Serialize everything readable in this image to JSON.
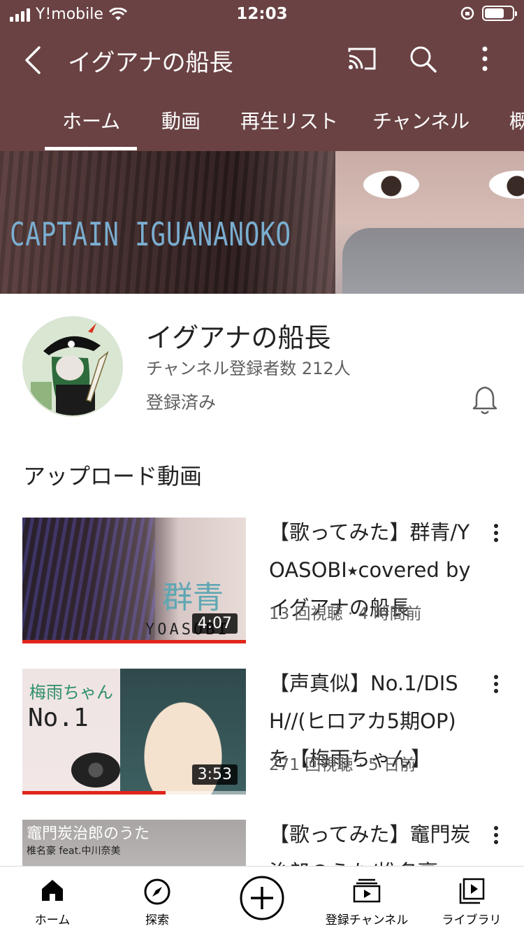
{
  "status_bar": {
    "carrier": "Y!mobile",
    "time": "12:03",
    "battery_level": 0.7
  },
  "app_bar": {
    "title": "イグアナの船長",
    "icons": [
      "back-icon",
      "cast-icon",
      "search-icon",
      "more-vert-icon"
    ]
  },
  "tabs": [
    {
      "label": "ホーム",
      "selected": true
    },
    {
      "label": "動画",
      "selected": false
    },
    {
      "label": "再生リスト",
      "selected": false
    },
    {
      "label": "チャンネル",
      "selected": false
    },
    {
      "label": "概",
      "selected": false
    }
  ],
  "banner": {
    "text": "CAPTAIN IGUANANOKO"
  },
  "channel": {
    "name": "イグアナの船長",
    "subscribers": "チャンネル登録者数 212人",
    "subscription_status": "登録済み"
  },
  "section": {
    "title": "アップロード動画"
  },
  "videos": [
    {
      "title": "【歌ってみた】群青/YOASOBI⭑covered by イグアナの船長",
      "meta": "13 回視聴 · 4 時間前",
      "duration": "4:07",
      "watched_fraction": 1.0,
      "thumb_text": [
        "群青",
        "YOASOBI"
      ]
    },
    {
      "title": "【声真似】No.1/DISH//(ヒロアカ5期OP)を【梅雨ちゃん】",
      "meta": "271 回視聴 · 5 日前",
      "duration": "3:53",
      "watched_fraction": 0.64,
      "thumb_text": [
        "梅雨ちゃん",
        "No.1"
      ]
    },
    {
      "title": "【歌ってみた】竈門炭治郎のうた/椎名豪",
      "meta": "",
      "duration": "",
      "watched_fraction": 0,
      "thumb_text": [
        "竈門炭治郎のうた",
        "椎名豪 feat.中川奈美"
      ]
    }
  ],
  "bottom_nav": [
    {
      "label": "ホーム",
      "icon": "home-icon",
      "selected": true
    },
    {
      "label": "探索",
      "icon": "compass-icon",
      "selected": false
    },
    {
      "label": "",
      "icon": "create-icon",
      "selected": false
    },
    {
      "label": "登録チャンネル",
      "icon": "subscriptions-icon",
      "selected": false
    },
    {
      "label": "ライブラリ",
      "icon": "library-icon",
      "selected": false
    }
  ],
  "colors": {
    "header_bg": "#6a4243",
    "progress_red": "#e1251b",
    "text_secondary": "#606060"
  }
}
